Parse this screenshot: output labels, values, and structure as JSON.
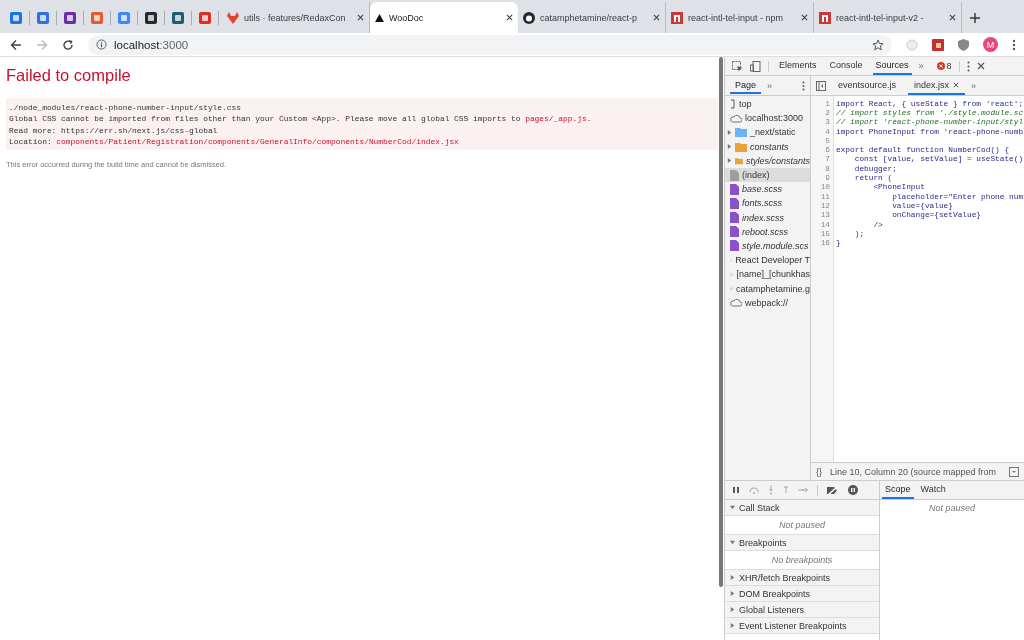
{
  "browser": {
    "tabs": [
      {
        "title": "utils · features/RedaxCon",
        "selected": false
      },
      {
        "title": "WooDoc",
        "selected": true
      },
      {
        "title": "catamphetamine/react-p",
        "selected": false
      },
      {
        "title": "react-intl-tel-input - npm",
        "selected": false
      },
      {
        "title": "react-intl-tel-input-v2 -",
        "selected": false
      }
    ],
    "address": {
      "host": "localhost",
      "port": ":3000"
    },
    "profile": "M"
  },
  "page": {
    "title": "Failed to compile",
    "error_lines": [
      {
        "text": "./node_modules/react-phone-number-input/style.css"
      },
      {
        "text": "Global CSS cannot be imported from files other than your Custom <App>. Please move all global CSS imports to ",
        "path": "pages/_app.js."
      },
      {
        "text": "Read more: https://err.sh/next.js/css-global"
      },
      {
        "text": "Location: ",
        "path": "components/Patient/Registration/components/GeneralInfo/components/NumberCod/index.jsx"
      }
    ],
    "note": "This error occurred during the build time and cannot be dismissed."
  },
  "devtools": {
    "tabs": [
      {
        "label": "Elements",
        "selected": false
      },
      {
        "label": "Console",
        "selected": false
      },
      {
        "label": "Sources",
        "selected": true
      }
    ],
    "more": "»",
    "error_count": "8",
    "navigator": {
      "tabs": [
        {
          "label": "Page",
          "selected": true
        }
      ],
      "more": "»",
      "tree": [
        {
          "label": "top",
          "kind": "frame",
          "selected": false,
          "children": [
            {
              "label": "localhost:3000",
              "kind": "domain",
              "selected": false,
              "children": [
                {
                  "label": "_next/static",
                  "kind": "folder",
                  "color": "#6fb2f2",
                  "expanded": false,
                  "source_mapped": false,
                  "selected": false
                },
                {
                  "label": "constants",
                  "kind": "folder",
                  "color": "#e8a33d",
                  "expanded": false,
                  "source_mapped": true,
                  "selected": false
                },
                {
                  "label": "styles/constants",
                  "kind": "folder",
                  "color": "#e8a33d",
                  "expanded": false,
                  "source_mapped": true,
                  "selected": false
                },
                {
                  "label": "(index)",
                  "kind": "file",
                  "color": "#9e9e9e",
                  "source_mapped": false,
                  "selected": true
                },
                {
                  "label": "base.scss",
                  "kind": "file",
                  "color": "#8a52c9",
                  "source_mapped": true,
                  "selected": false
                },
                {
                  "label": "fonts.scss",
                  "kind": "file",
                  "color": "#8a52c9",
                  "source_mapped": true,
                  "selected": false
                },
                {
                  "label": "index.scss",
                  "kind": "file",
                  "color": "#8a52c9",
                  "source_mapped": true,
                  "selected": false
                },
                {
                  "label": "reboot.scss",
                  "kind": "file",
                  "color": "#8a52c9",
                  "source_mapped": true,
                  "selected": false
                },
                {
                  "label": "style.module.scs",
                  "kind": "file",
                  "color": "#8a52c9",
                  "source_mapped": true,
                  "selected": false
                }
              ]
            },
            {
              "label": "React Developer T",
              "kind": "domain",
              "selected": false
            },
            {
              "label": "[name]_[chunkhas",
              "kind": "domain",
              "selected": false
            },
            {
              "label": "catamphetamine.g",
              "kind": "domain",
              "selected": false
            },
            {
              "label": "webpack://",
              "kind": "domain",
              "selected": false
            }
          ]
        }
      ]
    },
    "editor": {
      "tabs": [
        {
          "label": "eventsource.js",
          "selected": false
        },
        {
          "label": "index.jsx",
          "selected": true
        }
      ],
      "more": "»",
      "lines": [
        {
          "number": "1",
          "kind": "code",
          "text": "import React, { useState } from 'react';"
        },
        {
          "number": "2",
          "kind": "comment",
          "text": "// import styles from './style.module.sc"
        },
        {
          "number": "3",
          "kind": "comment",
          "text": "// import 'react-phone-number-input/styl"
        },
        {
          "number": "4",
          "kind": "code",
          "text": "import PhoneInput from 'react-phone-numb"
        },
        {
          "number": "5",
          "kind": "blank"
        },
        {
          "number": "6",
          "kind": "code",
          "text": "export default function NumberCod() {"
        },
        {
          "number": "7",
          "kind": "code",
          "text": "    const [value, setValue] = useState()"
        },
        {
          "number": "8",
          "kind": "code",
          "text": "    debugger;"
        },
        {
          "number": "9",
          "kind": "code",
          "text": "    return ("
        },
        {
          "number": "10",
          "kind": "code",
          "text": "        <PhoneInput"
        },
        {
          "number": "11",
          "kind": "code",
          "text": "            placeholder=\"Enter phone num"
        },
        {
          "number": "12",
          "kind": "code",
          "text": "            value={value}"
        },
        {
          "number": "13",
          "kind": "code",
          "text": "            onChange={setValue}"
        },
        {
          "number": "14",
          "kind": "code",
          "text": "        />"
        },
        {
          "number": "15",
          "kind": "code",
          "text": "    );"
        },
        {
          "number": "16",
          "kind": "code",
          "text": "}"
        }
      ],
      "format_button": "{}",
      "status": "Line 10, Column 20 (source mapped from"
    },
    "debugger": {
      "sections": [
        {
          "title": "Call Stack",
          "expanded": true,
          "message": "Not paused"
        },
        {
          "title": "Breakpoints",
          "expanded": true,
          "message": "No breakpoints"
        },
        {
          "title": "XHR/fetch Breakpoints",
          "expanded": false
        },
        {
          "title": "DOM Breakpoints",
          "expanded": false
        },
        {
          "title": "Global Listeners",
          "expanded": false
        },
        {
          "title": "Event Listener Breakpoints",
          "expanded": false
        }
      ],
      "side_tabs": [
        {
          "label": "Scope",
          "selected": true
        },
        {
          "label": "Watch",
          "selected": false
        }
      ],
      "side_message": "Not paused"
    }
  }
}
